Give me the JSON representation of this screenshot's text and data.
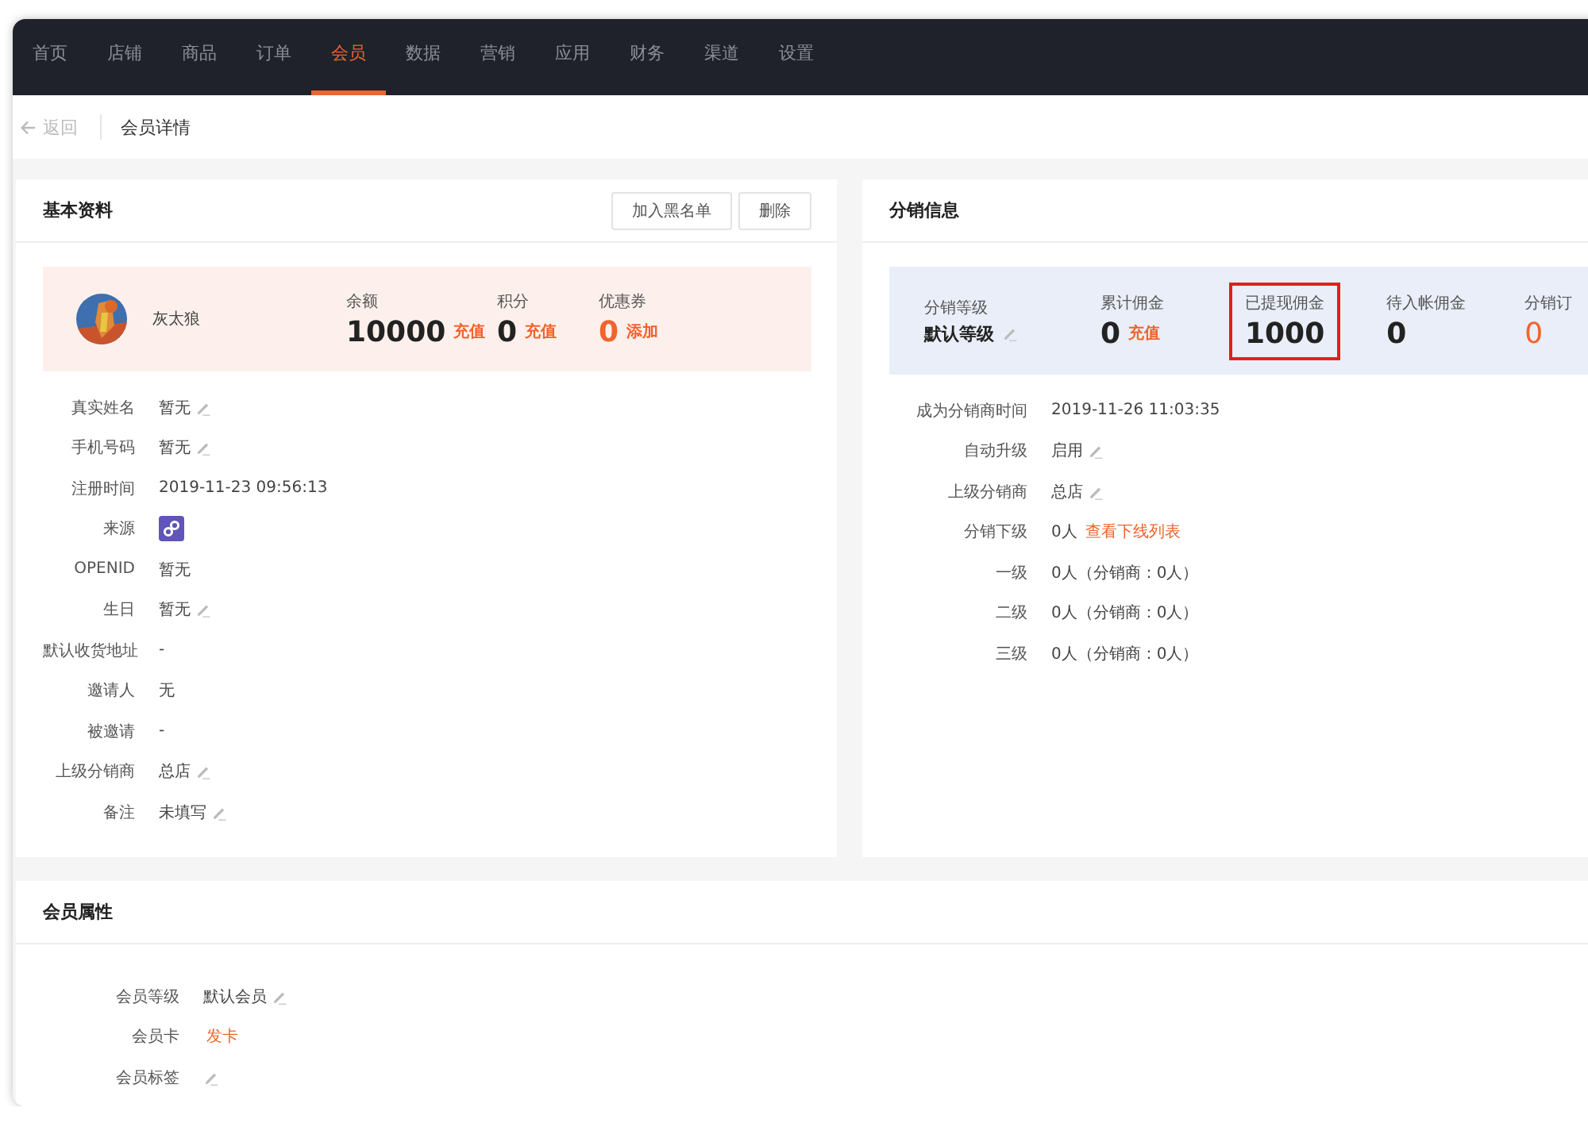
{
  "nav": [
    {
      "label": "首页",
      "selected": false
    },
    {
      "label": "店铺",
      "selected": false
    },
    {
      "label": "商品",
      "selected": false
    },
    {
      "label": "订单",
      "selected": false
    },
    {
      "label": "会员",
      "selected": true
    },
    {
      "label": "数据",
      "selected": false
    },
    {
      "label": "营销",
      "selected": false
    },
    {
      "label": "应用",
      "selected": false
    },
    {
      "label": "财务",
      "selected": false
    },
    {
      "label": "渠道",
      "selected": false
    },
    {
      "label": "设置",
      "selected": false
    }
  ],
  "breadcrumb": {
    "back": "返回",
    "title": "会员详情"
  },
  "basic": {
    "title": "基本资料",
    "buttons": [
      "加入黑名单",
      "删除"
    ],
    "profile": {
      "name": "灰太狼",
      "stats": [
        {
          "label": "余额",
          "value": "10000",
          "action": "充值",
          "highlight": false
        },
        {
          "label": "积分",
          "value": "0",
          "action": "充值",
          "highlight": false
        },
        {
          "label": "优惠券",
          "value": "0",
          "action": "添加",
          "highlight": true
        }
      ]
    },
    "fields": [
      {
        "label": "真实姓名",
        "kind": "text",
        "value": "暂无",
        "editable": true
      },
      {
        "label": "手机号码",
        "kind": "text",
        "value": "暂无",
        "editable": true
      },
      {
        "label": "注册时间",
        "kind": "text",
        "value": "2019-11-23 09:56:13",
        "editable": false
      },
      {
        "label": "来源",
        "kind": "source",
        "editable": false
      },
      {
        "label": "OPENID",
        "kind": "text",
        "value": "暂无",
        "editable": false
      },
      {
        "label": "生日",
        "kind": "text",
        "value": "暂无",
        "editable": true
      },
      {
        "label": "默认收货地址",
        "kind": "text",
        "value": "-",
        "editable": false
      },
      {
        "label": "邀请人",
        "kind": "text",
        "value": "无",
        "editable": false
      },
      {
        "label": "被邀请",
        "kind": "text",
        "value": "-",
        "editable": false
      },
      {
        "label": "上级分销商",
        "kind": "text",
        "value": "总店",
        "editable": true
      },
      {
        "label": "备注",
        "kind": "text",
        "value": "未填写",
        "editable": true
      }
    ]
  },
  "distribution": {
    "title": "分销信息",
    "stats": [
      {
        "label": "分销等级",
        "value": "默认等级",
        "kind": "level",
        "editable": true,
        "highlight": false,
        "boxed": false
      },
      {
        "label": "累计佣金",
        "value": "0",
        "kind": "amount",
        "action": "充值",
        "editable": false,
        "highlight": false,
        "boxed": false
      },
      {
        "label": "已提现佣金",
        "value": "1000",
        "kind": "amount",
        "editable": false,
        "highlight": false,
        "boxed": true
      },
      {
        "label": "待入帐佣金",
        "value": "0",
        "kind": "amount",
        "editable": false,
        "highlight": false,
        "boxed": false
      },
      {
        "label": "分销订",
        "value": "0",
        "kind": "amount",
        "editable": false,
        "highlight": true,
        "boxed": false
      }
    ],
    "fields": [
      {
        "label": "成为分销商时间",
        "value": "2019-11-26 11:03:35",
        "editable": false
      },
      {
        "label": "自动升级",
        "value": "启用",
        "editable": true
      },
      {
        "label": "上级分销商",
        "value": "总店",
        "editable": true
      },
      {
        "label": "分销下级",
        "value": "0人",
        "link": "查看下线列表",
        "editable": false
      },
      {
        "label": "一级",
        "value": "0人（分销商：0人）",
        "editable": false
      },
      {
        "label": "二级",
        "value": "0人（分销商：0人）",
        "editable": false
      },
      {
        "label": "三级",
        "value": "0人（分销商：0人）",
        "editable": false
      }
    ]
  },
  "attributes": {
    "title": "会员属性",
    "fields": [
      {
        "label": "会员等级",
        "kind": "text",
        "value": "默认会员",
        "editable": true
      },
      {
        "label": "会员卡",
        "kind": "link",
        "value": "发卡",
        "editable": false
      },
      {
        "label": "会员标签",
        "kind": "text",
        "editable": true
      }
    ]
  }
}
